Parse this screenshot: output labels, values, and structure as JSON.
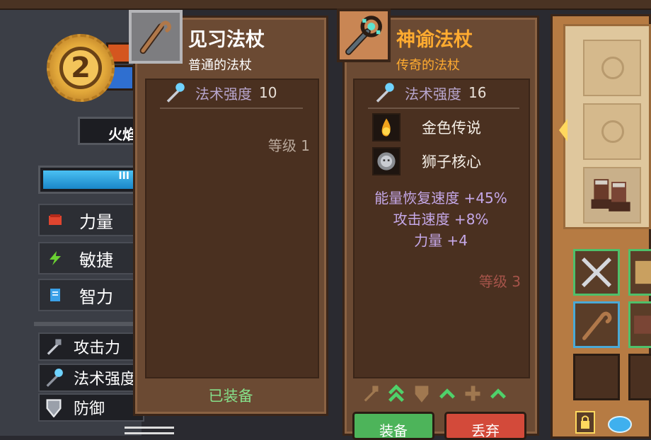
{
  "character": {
    "level": "2",
    "name_partial": "火焰",
    "bar_text": "III",
    "stats": [
      {
        "label": "力量",
        "icon": "fist-icon",
        "color": "#e0452f"
      },
      {
        "label": "敏捷",
        "icon": "lightning-icon",
        "color": "#6ad032"
      },
      {
        "label": "智力",
        "icon": "book-icon",
        "color": "#3aa0e8"
      }
    ],
    "combat_stats": [
      {
        "label": "攻击力",
        "icon": "sword-icon"
      },
      {
        "label": "法术强度",
        "icon": "wand-icon"
      },
      {
        "label": "防御",
        "icon": "shield-icon"
      }
    ]
  },
  "current_item": {
    "title": "见习法杖",
    "subtitle": "普通的法杖",
    "title_color": "#ffffff",
    "subtitle_color": "#ffffff",
    "stat_label": "法术强度",
    "stat_value": "10",
    "level_text": "等级 1",
    "equipped_text": "已装备"
  },
  "new_item": {
    "title": "神谕法杖",
    "subtitle": "传奇的法杖",
    "title_color": "#ffab30",
    "subtitle_color": "#ffab30",
    "stat_label": "法术强度",
    "stat_value": "16",
    "gems": [
      {
        "label": "金色传说",
        "icon": "flame-gem-icon"
      },
      {
        "label": "狮子核心",
        "icon": "lion-core-icon"
      }
    ],
    "bonuses": [
      "能量恢复速度 +45%",
      "攻击速度 +8%",
      "力量 +4"
    ],
    "level_text": "等级 3",
    "equip_button": "装备",
    "drop_button": "丢弃"
  },
  "colors": {
    "panel_brown": "#6b4a33",
    "inner_dark": "#4a3020",
    "legendary": "#ffab30",
    "bonus_purple": "#c5a8e8",
    "equipped_green": "#86e08a",
    "level_red": "#a6544a"
  }
}
